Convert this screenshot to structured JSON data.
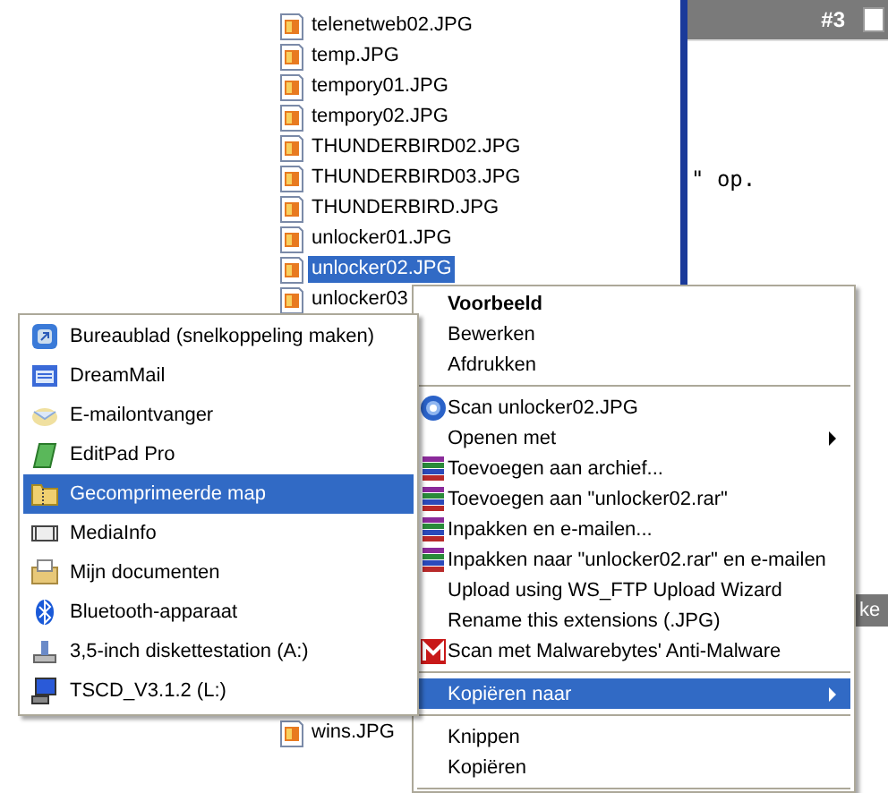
{
  "files": [
    {
      "name": "telenetweb02.JPG",
      "selected": false
    },
    {
      "name": "temp.JPG",
      "selected": false
    },
    {
      "name": "tempory01.JPG",
      "selected": false
    },
    {
      "name": "tempory02.JPG",
      "selected": false
    },
    {
      "name": "THUNDERBIRD02.JPG",
      "selected": false
    },
    {
      "name": "THUNDERBIRD03.JPG",
      "selected": false
    },
    {
      "name": "THUNDERBIRD.JPG",
      "selected": false
    },
    {
      "name": "unlocker01.JPG",
      "selected": false
    },
    {
      "name": "unlocker02.JPG",
      "selected": true
    },
    {
      "name": "unlocker03",
      "selected": false
    }
  ],
  "files_bottom": [
    {
      "name": "wins.JPG",
      "selected": false
    }
  ],
  "right_panel": {
    "header": "#3",
    "checked": false,
    "text": "\" op.",
    "bar_text": "ke"
  },
  "context_menu": [
    {
      "kind": "item",
      "label": "Voorbeeld",
      "default": true,
      "submenu": false,
      "selected": false
    },
    {
      "kind": "item",
      "label": "Bewerken",
      "default": false,
      "submenu": false,
      "selected": false
    },
    {
      "kind": "item",
      "label": "Afdrukken",
      "default": false,
      "submenu": false,
      "selected": false
    },
    {
      "kind": "separator"
    },
    {
      "kind": "item",
      "label": "Scan unlocker02.JPG",
      "default": false,
      "submenu": false,
      "selected": false
    },
    {
      "kind": "item",
      "label": "Openen met",
      "default": false,
      "submenu": true,
      "selected": false
    },
    {
      "kind": "item",
      "label": "Toevoegen aan archief...",
      "default": false,
      "submenu": false,
      "selected": false
    },
    {
      "kind": "item",
      "label": "Toevoegen aan \"unlocker02.rar\"",
      "default": false,
      "submenu": false,
      "selected": false
    },
    {
      "kind": "item",
      "label": "Inpakken en e-mailen...",
      "default": false,
      "submenu": false,
      "selected": false
    },
    {
      "kind": "item",
      "label": "Inpakken naar \"unlocker02.rar\" en e-mailen",
      "default": false,
      "submenu": false,
      "selected": false
    },
    {
      "kind": "item",
      "label": "Upload using WS_FTP Upload Wizard",
      "default": false,
      "submenu": false,
      "selected": false
    },
    {
      "kind": "item",
      "label": "Rename this extensions (.JPG)",
      "default": false,
      "submenu": false,
      "selected": false
    },
    {
      "kind": "item",
      "label": "Scan met Malwarebytes' Anti-Malware",
      "default": false,
      "submenu": false,
      "selected": false
    },
    {
      "kind": "separator"
    },
    {
      "kind": "item",
      "label": "Kopiëren naar",
      "default": false,
      "submenu": true,
      "selected": true
    },
    {
      "kind": "separator"
    },
    {
      "kind": "item",
      "label": "Knippen",
      "default": false,
      "submenu": false,
      "selected": false
    },
    {
      "kind": "item",
      "label": "Kopiëren",
      "default": false,
      "submenu": false,
      "selected": false
    },
    {
      "kind": "separator"
    }
  ],
  "send_to_menu": [
    {
      "label": "Bureaublad (snelkoppeling maken)",
      "selected": false
    },
    {
      "label": "DreamMail",
      "selected": false
    },
    {
      "label": "E-mailontvanger",
      "selected": false
    },
    {
      "label": "EditPad Pro",
      "selected": false
    },
    {
      "label": "Gecomprimeerde map",
      "selected": true
    },
    {
      "label": "MediaInfo",
      "selected": false
    },
    {
      "label": "Mijn documenten",
      "selected": false
    },
    {
      "label": "Bluetooth-apparaat",
      "selected": false
    },
    {
      "label": "3,5-inch diskettestation (A:)",
      "selected": false
    },
    {
      "label": "TSCD_V3.1.2 (L:)",
      "selected": false
    }
  ]
}
